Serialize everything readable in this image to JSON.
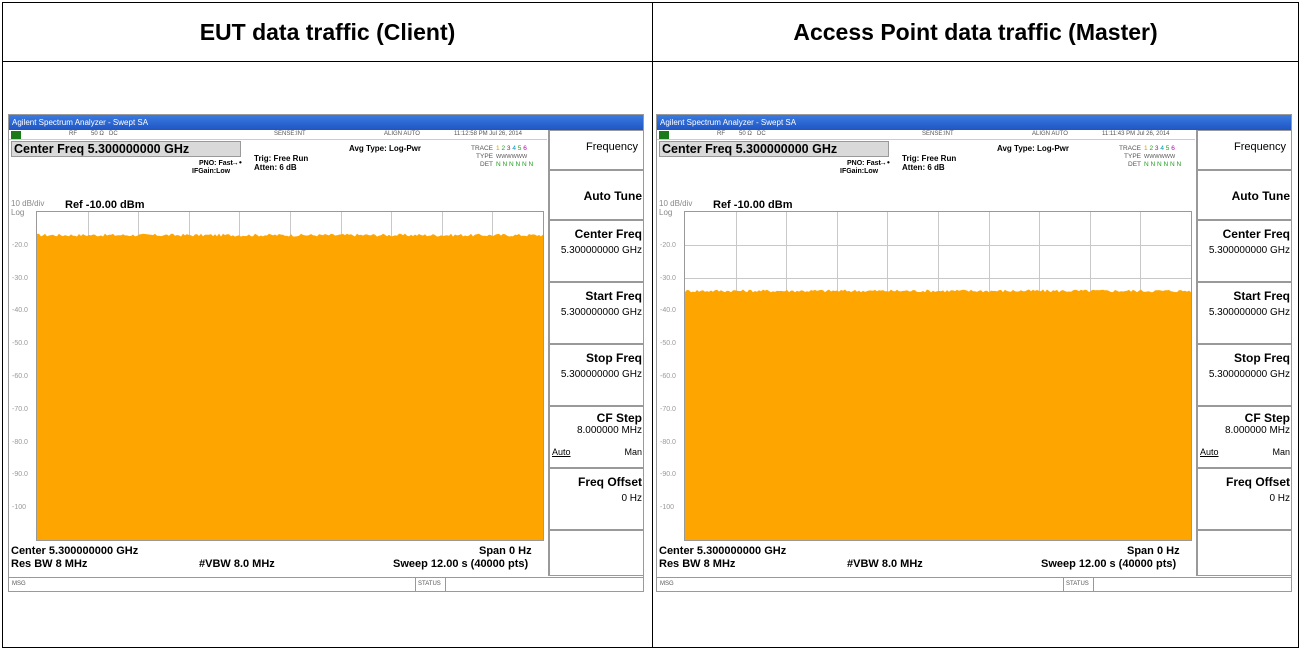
{
  "headers": {
    "left": "EUT data traffic (Client)",
    "right": "Access Point data traffic (Master)"
  },
  "panels": [
    {
      "id": "left",
      "window_title": "Agilent Spectrum Analyzer - Swept SA",
      "status": {
        "rf": "RF",
        "impedance": "50 Ω",
        "coupling": "DC",
        "sense": "SENSE:INT",
        "align": "ALIGN AUTO",
        "timestamp": "11:12:58 PM Jul 26, 2014"
      },
      "center_freq": "Center Freq 5.300000000 GHz",
      "pno": "PNO: Fast",
      "ifgain": "IFGain:Low",
      "trig": "Trig: Free Run",
      "atten": "Atten: 6 dB",
      "avg_type": "Avg Type: Log-Pwr",
      "trace_label": "TRACE",
      "type_label": "TYPE",
      "det_label": "DET",
      "trace_digits": [
        "1",
        "2",
        "3",
        "4",
        "5",
        "6"
      ],
      "type_value": "WWWWWW",
      "det_value": "N N N N N N",
      "scale": "10 dB/div",
      "log": "Log",
      "ref": "Ref -10.00 dBm",
      "y_labels": [
        "-20.0",
        "-30.0",
        "-40.0",
        "-50.0",
        "-60.0",
        "-70.0",
        "-80.0",
        "-90.0",
        "-100"
      ],
      "trace_level_dbm": -17.5,
      "trace_color": "#ffa500",
      "bottom": {
        "center": "Center 5.300000000 GHz",
        "span": "Span 0 Hz",
        "res_bw": "Res BW 8 MHz",
        "vbw": "#VBW 8.0 MHz",
        "sweep": "Sweep  12.00 s (40000 pts)"
      },
      "msg": "MSG",
      "status_label": "STATUS",
      "softkeys": {
        "title": "Frequency",
        "auto_tune": "Auto Tune",
        "center_freq": {
          "label": "Center Freq",
          "value": "5.300000000 GHz"
        },
        "start_freq": {
          "label": "Start Freq",
          "value": "5.300000000 GHz"
        },
        "stop_freq": {
          "label": "Stop Freq",
          "value": "5.300000000 GHz"
        },
        "cf_step": {
          "label": "CF Step",
          "value": "8.000000 MHz",
          "auto": "Auto",
          "man": "Man"
        },
        "freq_offset": {
          "label": "Freq Offset",
          "value": "0 Hz"
        }
      }
    },
    {
      "id": "right",
      "window_title": "Agilent Spectrum Analyzer - Swept SA",
      "status": {
        "rf": "RF",
        "impedance": "50 Ω",
        "coupling": "DC",
        "sense": "SENSE:INT",
        "align": "ALIGN AUTO",
        "timestamp": "11:11:43 PM Jul 26, 2014"
      },
      "center_freq": "Center Freq 5.300000000 GHz",
      "pno": "PNO: Fast",
      "ifgain": "IFGain:Low",
      "trig": "Trig: Free Run",
      "atten": "Atten: 6 dB",
      "avg_type": "Avg Type: Log-Pwr",
      "trace_label": "TRACE",
      "type_label": "TYPE",
      "det_label": "DET",
      "trace_digits": [
        "1",
        "2",
        "3",
        "4",
        "5",
        "6"
      ],
      "type_value": "WWWWWW",
      "det_value": "N N N N N N",
      "scale": "10 dB/div",
      "log": "Log",
      "ref": "Ref -10.00 dBm",
      "y_labels": [
        "-20.0",
        "-30.0",
        "-40.0",
        "-50.0",
        "-60.0",
        "-70.0",
        "-80.0",
        "-90.0",
        "-100"
      ],
      "trace_level_dbm": -34.5,
      "trace_color": "#ffa500",
      "bottom": {
        "center": "Center 5.300000000 GHz",
        "span": "Span 0 Hz",
        "res_bw": "Res BW 8 MHz",
        "vbw": "#VBW 8.0 MHz",
        "sweep": "Sweep  12.00 s (40000 pts)"
      },
      "msg": "MSG",
      "status_label": "STATUS",
      "softkeys": {
        "title": "Frequency",
        "auto_tune": "Auto Tune",
        "center_freq": {
          "label": "Center Freq",
          "value": "5.300000000 GHz"
        },
        "start_freq": {
          "label": "Start Freq",
          "value": "5.300000000 GHz"
        },
        "stop_freq": {
          "label": "Stop Freq",
          "value": "5.300000000 GHz"
        },
        "cf_step": {
          "label": "CF Step",
          "value": "8.000000 MHz",
          "auto": "Auto",
          "man": "Man"
        },
        "freq_offset": {
          "label": "Freq Offset",
          "value": "0 Hz"
        }
      }
    }
  ],
  "plot_scale": {
    "ref_dbm": -10,
    "db_per_div": 10,
    "divisions": 10
  }
}
